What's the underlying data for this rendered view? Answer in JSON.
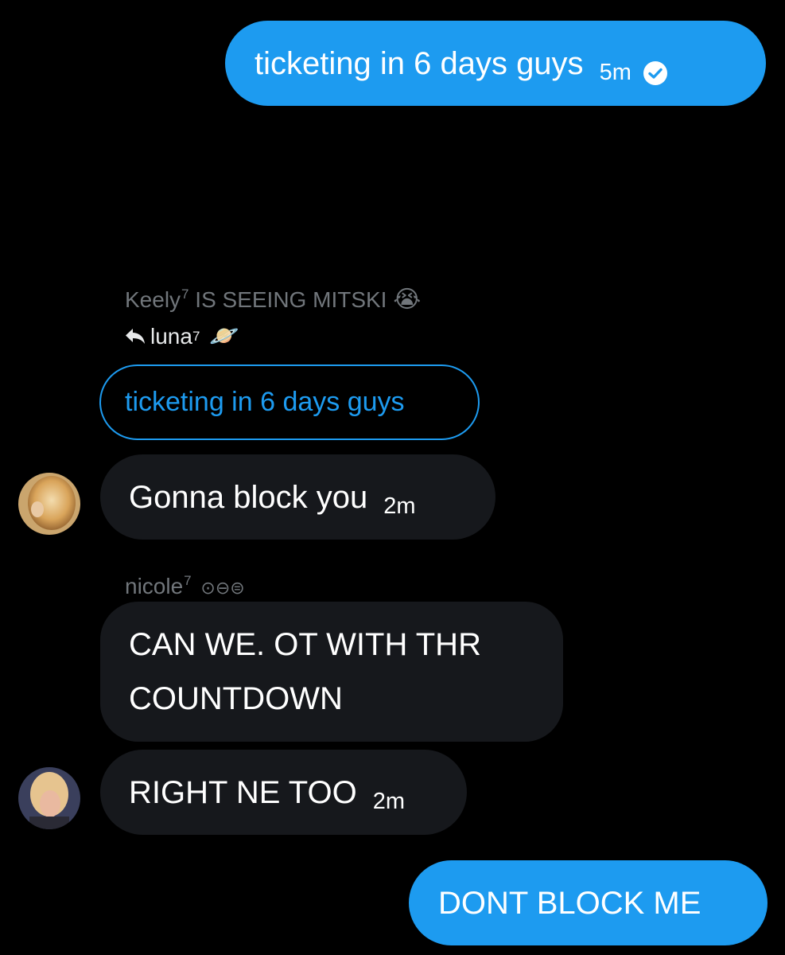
{
  "messages": [
    {
      "text": "ticketing in 6 days guys",
      "time": "5m",
      "status_icon": "check-circle-icon"
    },
    {
      "sender_name": "Keely",
      "sender_sup": "7",
      "sender_status": "IS SEEING MITSKI",
      "sender_emoji": "😭",
      "reply_to_name": "luna",
      "reply_to_sup": "7",
      "reply_to_emoji": "🪐",
      "quoted_text": "ticketing in 6 days guys",
      "text": "Gonna block you",
      "time": "2m"
    },
    {
      "sender_name": "nicole",
      "sender_sup": "7",
      "sender_suffix": "⊙⊖⊜",
      "text": "CAN WE. OT WITH THR\nCOUNTDOWN"
    },
    {
      "text": "RIGHT NE TOO",
      "time": "2m"
    },
    {
      "text": "DONT BLOCK ME"
    }
  ],
  "colors": {
    "background": "#000000",
    "sent_bubble": "#1d9bf0",
    "received_bubble": "#16181c",
    "muted_text": "#71767b",
    "accent": "#1d9bf0"
  }
}
